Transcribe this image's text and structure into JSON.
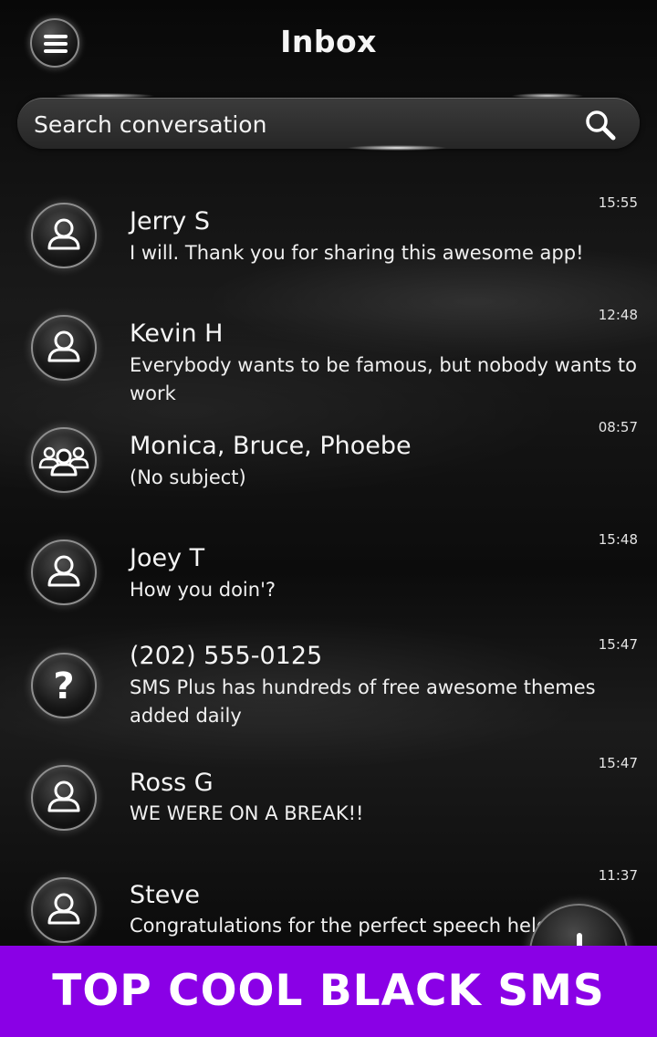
{
  "header": {
    "title": "Inbox",
    "menu_icon": "hamburger-menu-icon"
  },
  "search": {
    "placeholder": "Search conversation",
    "icon": "search-icon"
  },
  "conversations": [
    {
      "name": "Jerry S",
      "snippet": " I will. Thank you for sharing this awesome app!",
      "time": "15:55",
      "avatar": "person-icon"
    },
    {
      "name": "Kevin H",
      "snippet": " Everybody wants to be famous, but nobody wants to work",
      "time": "12:48",
      "avatar": "person-icon"
    },
    {
      "name": "Monica, Bruce, Phoebe",
      "snippet": "(No subject)",
      "time": "08:57",
      "avatar": "group-icon"
    },
    {
      "name": "Joey T",
      "snippet": " How you doin'?",
      "time": "15:48",
      "avatar": "person-icon"
    },
    {
      "name": "(202) 555-0125",
      "snippet": " SMS Plus has hundreds of free awesome themes added daily",
      "time": "15:47",
      "avatar": "unknown-contact-icon"
    },
    {
      "name": "Ross G",
      "snippet": " WE WERE ON A BREAK!!",
      "time": "15:47",
      "avatar": "person-icon"
    },
    {
      "name": "Steve",
      "snippet": "Congratulations for the perfect speech held tod",
      "time": "11:37",
      "avatar": "person-icon"
    }
  ],
  "fab": {
    "icon": "compose-plus-icon"
  },
  "banner": {
    "text": "TOP COOL BLACK SMS"
  },
  "colors": {
    "banner": "#8a00e6",
    "background": "#0c0c0c",
    "text": "#f5f5f5"
  }
}
